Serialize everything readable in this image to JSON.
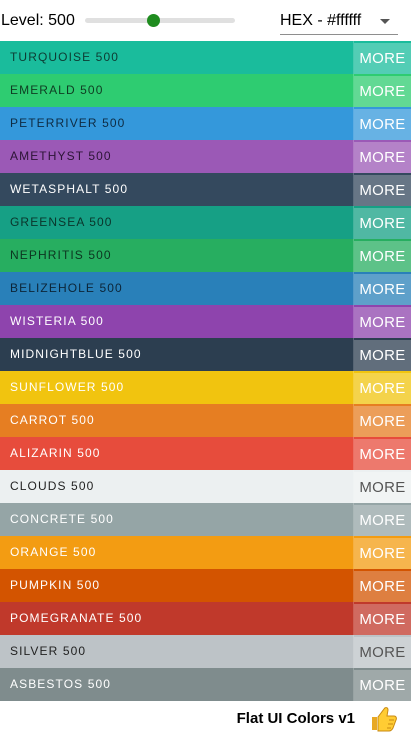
{
  "toolbar": {
    "level_label": "Level: 500",
    "slider_value_fraction": 0.45,
    "format_value": "HEX - #ffffff",
    "slider_color": "#1f8c1f"
  },
  "colors": [
    {
      "name": "TURQUOISE 500",
      "bg": "#1abc9c",
      "text": "#0d3b33",
      "more": "MORE"
    },
    {
      "name": "EMERALD 500",
      "bg": "#2ecc71",
      "text": "#0f3d22",
      "more": "MORE"
    },
    {
      "name": "PETERRIVER 500",
      "bg": "#3498db",
      "text": "#0e2c44",
      "more": "MORE"
    },
    {
      "name": "AMETHYST 500",
      "bg": "#9b59b6",
      "text": "#2c1436",
      "more": "MORE"
    },
    {
      "name": "WETASPHALT 500",
      "bg": "#34495e",
      "text": "#ffffff",
      "more": "MORE"
    },
    {
      "name": "GREENSEA 500",
      "bg": "#16a085",
      "text": "#0a342b",
      "more": "MORE"
    },
    {
      "name": "NEPHRITIS 500",
      "bg": "#27ae60",
      "text": "#0c3520",
      "more": "MORE"
    },
    {
      "name": "BELIZEHOLE 500",
      "bg": "#2980b9",
      "text": "#0c2538",
      "more": "MORE"
    },
    {
      "name": "WISTERIA 500",
      "bg": "#8e44ad",
      "text": "#ffffff",
      "more": "MORE"
    },
    {
      "name": "MIDNIGHTBLUE 500",
      "bg": "#2c3e50",
      "text": "#ffffff",
      "more": "MORE"
    },
    {
      "name": "SUNFLOWER 500",
      "bg": "#f1c40f",
      "text": "#ffffff",
      "more": "MORE"
    },
    {
      "name": "CARROT 500",
      "bg": "#e67e22",
      "text": "#ffffff",
      "more": "MORE"
    },
    {
      "name": "ALIZARIN 500",
      "bg": "#e74c3c",
      "text": "#ffffff",
      "more": "MORE"
    },
    {
      "name": "CLOUDS 500",
      "bg": "#ecf0f1",
      "text": "#222222",
      "more": "MORE"
    },
    {
      "name": "CONCRETE 500",
      "bg": "#95a5a6",
      "text": "#ffffff",
      "more": "MORE"
    },
    {
      "name": "ORANGE 500",
      "bg": "#f39c12",
      "text": "#ffffff",
      "more": "MORE"
    },
    {
      "name": "PUMPKIN 500",
      "bg": "#d35400",
      "text": "#ffffff",
      "more": "MORE"
    },
    {
      "name": "POMEGRANATE 500",
      "bg": "#c0392b",
      "text": "#ffffff",
      "more": "MORE"
    },
    {
      "name": "SILVER 500",
      "bg": "#bdc3c7",
      "text": "#222222",
      "more": "MORE"
    },
    {
      "name": "ASBESTOS 500",
      "bg": "#7f8c8d",
      "text": "#ffffff",
      "more": "MORE"
    }
  ],
  "footer": {
    "title": "Flat UI Colors v1",
    "icon": "thumbs-up-icon"
  }
}
